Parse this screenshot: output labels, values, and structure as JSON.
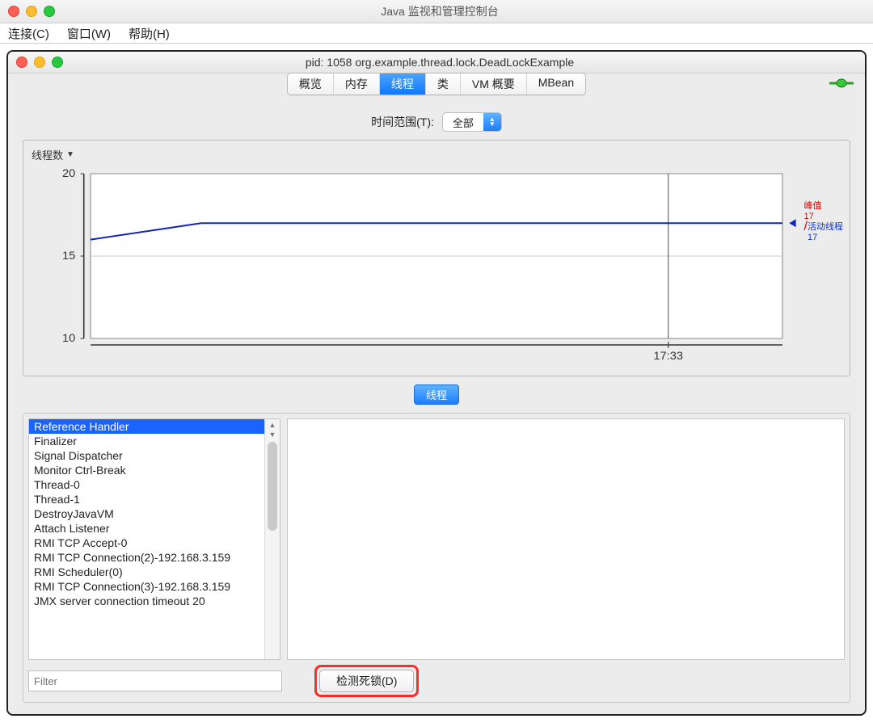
{
  "outer_window": {
    "title": "Java 监视和管理控制台"
  },
  "menubar": {
    "items": [
      "连接(C)",
      "窗口(W)",
      "帮助(H)"
    ]
  },
  "inner_window": {
    "title": "pid: 1058 org.example.thread.lock.DeadLockExample"
  },
  "tabs": {
    "items": [
      "概览",
      "内存",
      "线程",
      "类",
      "VM 概要",
      "MBean"
    ],
    "active_index": 2
  },
  "time_range": {
    "label": "时间范围(T):",
    "value": "全部"
  },
  "chart_section_title": "线程数",
  "legend": {
    "peak_label": "峰值",
    "peak_value": "17",
    "live_label": "活动线程",
    "live_value": "17"
  },
  "chart_data": {
    "type": "line",
    "title": "线程数",
    "xlabel": "",
    "ylabel": "",
    "ylim": [
      10,
      20
    ],
    "y_ticks": [
      10,
      15,
      20
    ],
    "x_tick_labels": [
      "17:33"
    ],
    "series": [
      {
        "name": "活动线程",
        "color": "#1226b5",
        "points": [
          {
            "x": 0.0,
            "y": 16
          },
          {
            "x": 0.16,
            "y": 17
          },
          {
            "x": 1.0,
            "y": 17
          }
        ]
      }
    ],
    "marker_x": 0.835
  },
  "threads_header_button": "线程",
  "threads": {
    "items": [
      "Reference Handler",
      "Finalizer",
      "Signal Dispatcher",
      "Monitor Ctrl-Break",
      "Thread-0",
      "Thread-1",
      "DestroyJavaVM",
      "Attach Listener",
      "RMI TCP Accept-0",
      "RMI TCP Connection(2)-192.168.3.159",
      "RMI Scheduler(0)",
      "RMI TCP Connection(3)-192.168.3.159",
      "JMX server connection timeout 20"
    ],
    "selected_index": 0
  },
  "filter": {
    "placeholder": "Filter"
  },
  "detect_button": "检测死锁(D)"
}
